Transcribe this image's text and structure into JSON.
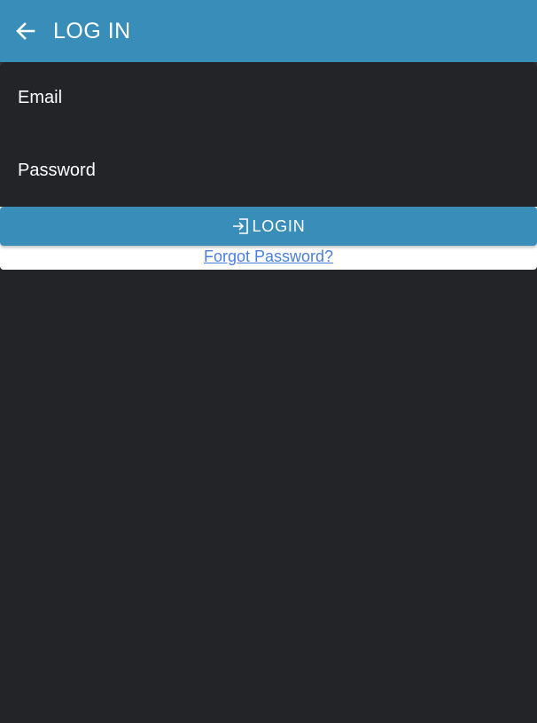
{
  "header": {
    "back_icon": "arrow-left-icon",
    "title": "LOG IN",
    "background_color": "#388db9"
  },
  "form": {
    "email": {
      "placeholder": "Email",
      "value": ""
    },
    "password": {
      "placeholder": "Password",
      "value": ""
    },
    "login_button": {
      "icon": "login-icon",
      "label": "LOGIN",
      "color": "#388db9"
    },
    "forgot_link": {
      "label": "Forgot Password?",
      "color": "#4a7fe0"
    }
  },
  "theme": {
    "background": "#232428",
    "text": "#ffffff"
  }
}
